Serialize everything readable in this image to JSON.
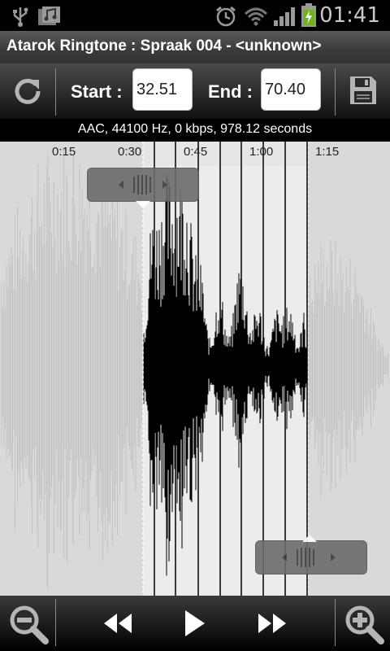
{
  "status": {
    "time": "01:41"
  },
  "title": "Atarok Ringtone : Spraak 004 - <unknown>",
  "toolbar": {
    "start_label": "Start :",
    "start_value": "32.51",
    "end_label": "End :",
    "end_value": "70.40"
  },
  "info": "AAC, 44100 Hz, 0 kbps, 978.12 seconds",
  "timeline": {
    "ticks": [
      "0:15",
      "0:30",
      "0:45",
      "1:00",
      "1:15"
    ]
  },
  "icons": {
    "reset": "reset-icon",
    "save": "save-icon",
    "zoom_out": "zoom-out-icon",
    "rewind": "rewind-icon",
    "play": "play-icon",
    "fast_forward": "fast-forward-icon",
    "zoom_in": "zoom-in-icon"
  }
}
